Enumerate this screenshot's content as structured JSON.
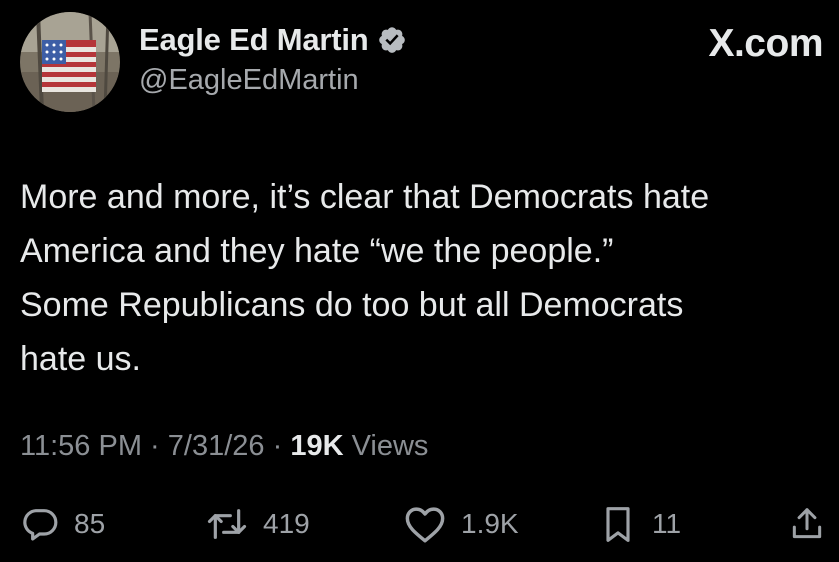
{
  "author": {
    "display_name": "Eagle Ed Martin",
    "handle": "@EagleEdMartin",
    "verified": true,
    "avatar_icon": "american-flag-avatar-icon",
    "verified_icon": "verified-badge-icon"
  },
  "brand": {
    "label": "X.com"
  },
  "tweet": {
    "text": "More and more, it’s clear that Democrats hate\nAmerica and they hate “we the people.”\nSome Republicans do too but all Democrats\nhate us."
  },
  "meta": {
    "time": "11:56 PM",
    "sep1": " · ",
    "date": "7/31/26",
    "sep2": " · ",
    "views_count": "19K",
    "views_label": " Views"
  },
  "actions": {
    "replies": {
      "icon": "reply-icon",
      "count": "85"
    },
    "reposts": {
      "icon": "repost-icon",
      "count": "419"
    },
    "likes": {
      "icon": "heart-icon",
      "count": "1.9K"
    },
    "bookmarks": {
      "icon": "bookmark-icon",
      "count": "11"
    },
    "share": {
      "icon": "share-icon"
    }
  },
  "colors": {
    "background": "#000000",
    "primary_text": "#e7e9ea",
    "secondary_text": "#8b8f94",
    "verified_badge": "#b8bcc0"
  }
}
